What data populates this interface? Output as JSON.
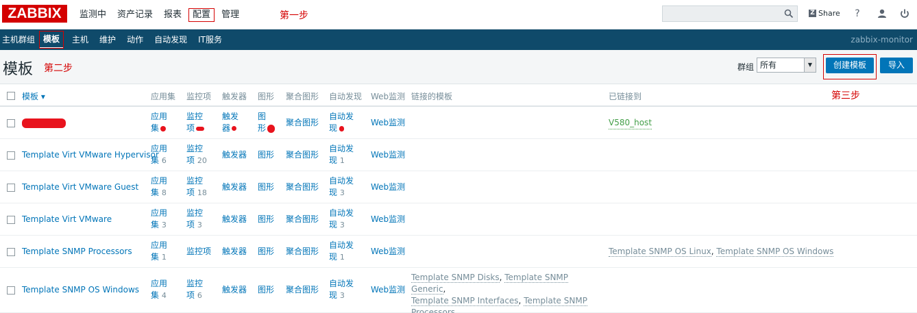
{
  "header": {
    "logo": "ZABBIX",
    "menu": [
      {
        "label": "监测中",
        "boxed": false
      },
      {
        "label": "资产记录",
        "boxed": false
      },
      {
        "label": "报表",
        "boxed": false
      },
      {
        "label": "配置",
        "boxed": true
      },
      {
        "label": "管理",
        "boxed": false
      }
    ],
    "step1": "第一步",
    "search_value": "",
    "share_label": "Share",
    "help_icon": "question-icon",
    "user_icon": "user-icon",
    "power_icon": "power-icon"
  },
  "submenu": {
    "items": [
      {
        "label": "主机群组",
        "active": false
      },
      {
        "label": "模板",
        "active": true
      },
      {
        "label": "主机",
        "active": false
      },
      {
        "label": "维护",
        "active": false
      },
      {
        "label": "动作",
        "active": false
      },
      {
        "label": "自动发现",
        "active": false
      },
      {
        "label": "IT服务",
        "active": false
      }
    ],
    "server": "zabbix-monitor"
  },
  "titlebar": {
    "title": "模板",
    "step2": "第二步",
    "group_label": "群组",
    "group_value": "所有",
    "create_button": "创建模板",
    "import_button": "导入",
    "step3": "第三步"
  },
  "table": {
    "headers": {
      "name": "模板 ▾",
      "apps": "应用集",
      "items": "监控项",
      "triggers": "触发器",
      "graphs": "图形",
      "screens": "聚合图形",
      "discovery": "自动发现",
      "web": "Web监测",
      "linked_templates": "链接的模板",
      "linked_to": "已链接到"
    },
    "rows": [
      {
        "name": "",
        "redacted": true,
        "apps_l1": "应用",
        "apps_l2": "集",
        "apps_count": "",
        "items_l1": "监控",
        "items_l2": "项",
        "items_count": "",
        "triggers_l1": "触发",
        "triggers_l2": "器",
        "graphs_l1": "图",
        "graphs_l2": "形",
        "screens": "聚合图形",
        "disc_l1": "自动发",
        "disc_l2": "现",
        "disc_count": "",
        "web": "Web监测",
        "linked_templates": [],
        "linked_to": [
          "V580_host"
        ]
      },
      {
        "name": "Template Virt VMware Hypervisor",
        "redacted": false,
        "apps_l1": "应用",
        "apps_l2": "集",
        "apps_count": "6",
        "items_l1": "监控",
        "items_l2": "项",
        "items_count": "20",
        "triggers": "触发器",
        "graphs": "图形",
        "screens": "聚合图形",
        "disc_l1": "自动发",
        "disc_l2": "现",
        "disc_count": "1",
        "web": "Web监测",
        "linked_templates": [],
        "linked_to": []
      },
      {
        "name": "Template Virt VMware Guest",
        "redacted": false,
        "apps_l1": "应用",
        "apps_l2": "集",
        "apps_count": "8",
        "items_l1": "监控",
        "items_l2": "项",
        "items_count": "18",
        "triggers": "触发器",
        "graphs": "图形",
        "screens": "聚合图形",
        "disc_l1": "自动发",
        "disc_l2": "现",
        "disc_count": "3",
        "web": "Web监测",
        "linked_templates": [],
        "linked_to": []
      },
      {
        "name": "Template Virt VMware",
        "redacted": false,
        "apps_l1": "应用",
        "apps_l2": "集",
        "apps_count": "3",
        "items_l1": "监控",
        "items_l2": "项",
        "items_count": "3",
        "triggers": "触发器",
        "graphs": "图形",
        "screens": "聚合图形",
        "disc_l1": "自动发",
        "disc_l2": "现",
        "disc_count": "3",
        "web": "Web监测",
        "linked_templates": [],
        "linked_to": []
      },
      {
        "name": "Template SNMP Processors",
        "redacted": false,
        "apps_l1": "应用",
        "apps_l2": "集",
        "apps_count": "1",
        "items": "监控项",
        "triggers": "触发器",
        "graphs": "图形",
        "screens": "聚合图形",
        "disc_l1": "自动发",
        "disc_l2": "现",
        "disc_count": "1",
        "web": "Web监测",
        "linked_templates": [],
        "linked_to": [
          "Template SNMP OS Linux",
          "Template SNMP OS Windows"
        ]
      },
      {
        "name": "Template SNMP OS Windows",
        "redacted": false,
        "apps_l1": "应用",
        "apps_l2": "集",
        "apps_count": "4",
        "items_l1": "监控",
        "items_l2": "项",
        "items_count": "6",
        "triggers": "触发器",
        "graphs": "图形",
        "screens": "聚合图形",
        "disc_l1": "自动发",
        "disc_l2": "现",
        "disc_count": "3",
        "web": "Web监测",
        "linked_templates": [
          "Template SNMP Disks",
          "Template SNMP Generic",
          "Template SNMP Interfaces",
          "Template SNMP Processors"
        ],
        "linked_to": []
      }
    ]
  }
}
